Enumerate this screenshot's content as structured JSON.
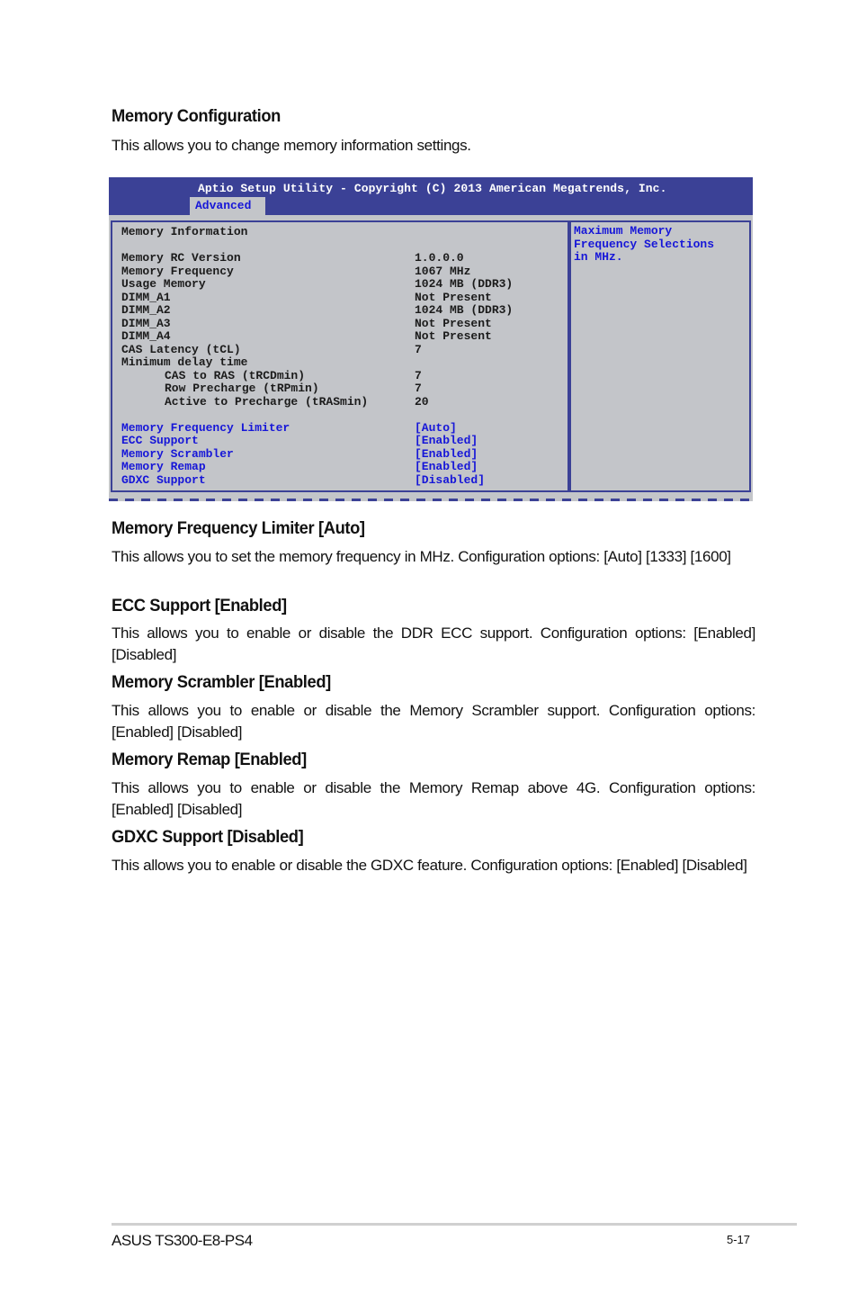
{
  "section": {
    "title": "Memory Configuration",
    "description": "This allows you to change memory information settings."
  },
  "bios": {
    "title": "Aptio Setup Utility - Copyright (C) 2013 American Megatrends, Inc.",
    "active_tab": "Advanced",
    "heading": "Memory Information",
    "info_rows": [
      {
        "label": "Memory RC Version",
        "value": "1.0.0.0"
      },
      {
        "label": "Memory Frequency",
        "value": "1067 MHz"
      },
      {
        "label": "Usage Memory",
        "value": "1024 MB (DDR3)"
      },
      {
        "label": "DIMM_A1",
        "value": "Not Present"
      },
      {
        "label": "DIMM_A2",
        "value": "1024 MB (DDR3)"
      },
      {
        "label": "DIMM_A3",
        "value": "Not Present"
      },
      {
        "label": "DIMM_A4",
        "value": "Not Present"
      },
      {
        "label": "CAS Latency (tCL)",
        "value": "7"
      },
      {
        "label": "Minimum delay time",
        "value": ""
      }
    ],
    "delay_rows": [
      {
        "label": "CAS to RAS (tRCDmin)",
        "value": "7"
      },
      {
        "label": "Row Precharge (tRPmin)",
        "value": "7"
      },
      {
        "label": "Active to Precharge (tRASmin)",
        "value": "20"
      }
    ],
    "settings": [
      {
        "label": "Memory Frequency Limiter",
        "value": "[Auto]"
      },
      {
        "label": "ECC Support",
        "value": "[Enabled]"
      },
      {
        "label": "Memory Scrambler",
        "value": "[Enabled]"
      },
      {
        "label": "Memory Remap",
        "value": "[Enabled]"
      },
      {
        "label": "GDXC Support",
        "value": "[Disabled]"
      }
    ],
    "help_text": "Maximum Memory\nFrequency Selections\nin MHz."
  },
  "items": [
    {
      "title": "Memory Frequency Limiter [Auto]",
      "description": "This allows you to set the memory frequency in MHz. Configuration options: [Auto] [1333] [1600]"
    },
    {
      "title": "ECC Support [Enabled]",
      "description": "This allows you to enable or disable the DDR ECC support. Configuration options: [Enabled] [Disabled]"
    },
    {
      "title": "Memory Scrambler [Enabled]",
      "description": "This allows you to enable or disable the Memory Scrambler support. Configuration options: [Enabled] [Disabled]"
    },
    {
      "title": "Memory Remap [Enabled]",
      "description": "This allows you to enable or disable the Memory Remap above 4G. Configuration options: [Enabled] [Disabled]"
    },
    {
      "title": "GDXC Support [Disabled]",
      "description": "This allows you to enable or disable the GDXC feature. Configuration options: [Enabled] [Disabled]"
    }
  ],
  "footer": {
    "product": "ASUS TS300-E8-PS4",
    "page_number": "5-17"
  }
}
